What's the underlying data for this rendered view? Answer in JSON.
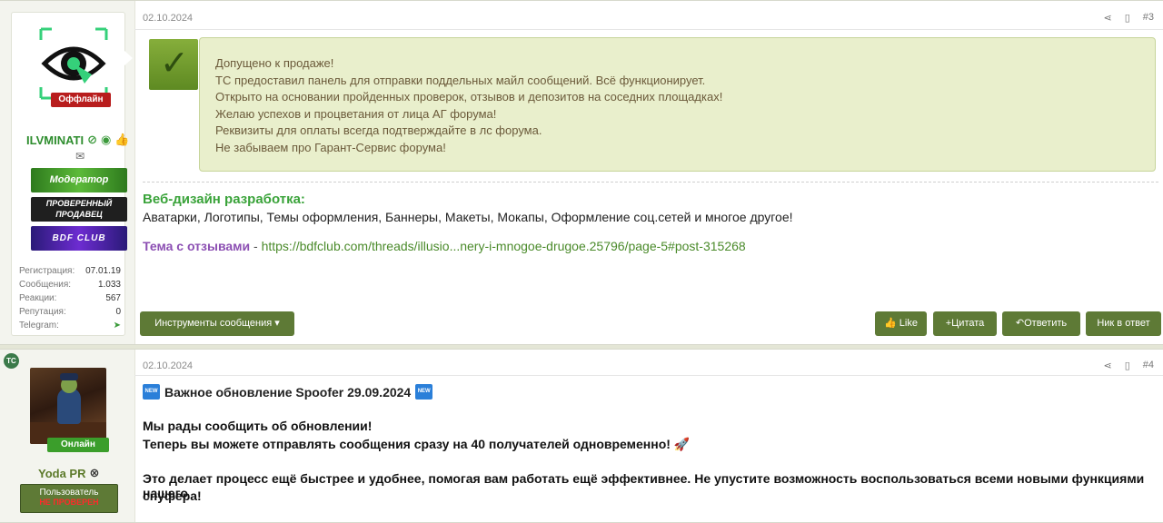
{
  "post1": {
    "date": "02.10.2024",
    "number": "#3",
    "user": {
      "status": "Оффлайн",
      "username": "ILVMINATI",
      "banners": {
        "moderator": "Модератор",
        "seller_line1": "ПРОВЕРЕННЫЙ",
        "seller_line2": "ПРОДАВЕЦ",
        "club": "BDF CLUB"
      },
      "stats": [
        {
          "label": "Регистрация:",
          "value": "07.01.19"
        },
        {
          "label": "Сообщения:",
          "value": "1.033"
        },
        {
          "label": "Реакции:",
          "value": "567"
        },
        {
          "label": "Репутация:",
          "value": "0"
        },
        {
          "label": "Telegram:",
          "value": ""
        }
      ]
    },
    "notice_lines": [
      "Допущено к продаже!",
      "ТС предоставил панель для отправки поддельных майл сообщений. Всё функционирует.",
      "Открыто на основании пройденных проверок, отзывов и депозитов на соседних площадках!",
      "Желаю успехов и процветания от лица АГ форума!",
      "Реквизиты для оплаты всегда подтверждайте в лс форума.",
      "Не забываем про Гарант-Сервис форума!"
    ],
    "signature": {
      "title": "Веб-дизайн разработка:",
      "text": "Аватарки, Логотипы, Темы оформления, Баннеры, Макеты, Мокапы, Оформление соц.сетей и многое другое!",
      "link_label": "Тема с отзывами",
      "link_dash": " - ",
      "link_url": "https://bdfclub.com/threads/illusio...nery-i-mnogoe-drugoe.25796/page-5#post-315268"
    },
    "buttons": {
      "tools": "Инструменты сообщения ▾",
      "like": "Like",
      "quote": "Цитата",
      "reply": "Ответить",
      "nick": "Ник в ответ"
    }
  },
  "post2": {
    "date": "02.10.2024",
    "number": "#4",
    "user": {
      "badge": "TC",
      "status": "Онлайн",
      "username": "Yoda PR",
      "rank_line1": "Пользователь",
      "rank_line2": "НЕ ПРОВЕРЕН"
    },
    "title": "Важное обновление Spoofer 29.09.2024",
    "new_badge": "NEW",
    "lines": [
      "Мы рады сообщить об обновлении!",
      "Теперь вы можете отправлять сообщения сразу на 40 получателей одновременно! 🚀",
      "Это делает процесс ещё быстрее и удобнее, помогая вам работать ещё эффективнее. Не упустите возможность воспользоваться всеми новыми функциями нашего",
      "спуфера!"
    ]
  },
  "colors": {
    "accent": "#5e7a36",
    "online": "#3b9e2b",
    "offline": "#b81d1d",
    "username": "#2e8d2e"
  }
}
